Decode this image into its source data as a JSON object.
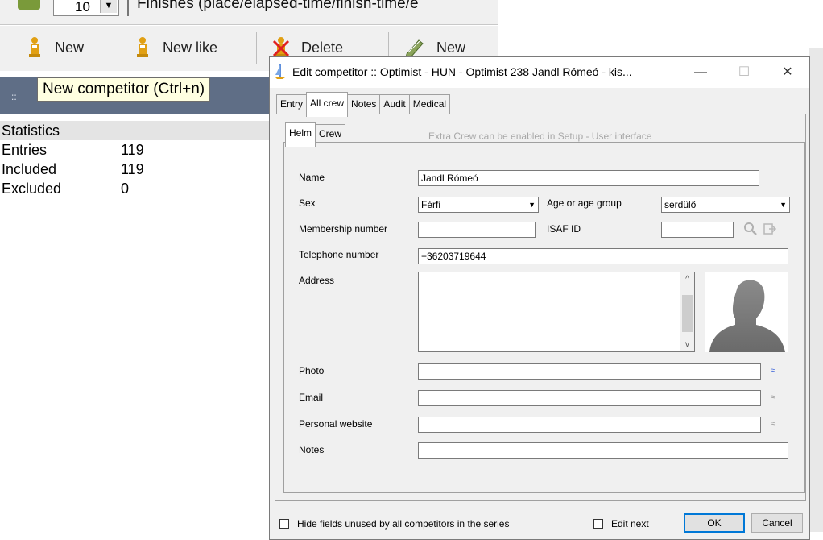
{
  "app": {
    "top_combo_value": "10",
    "finishes_text": "Finishes (place/elapsed-time/finish-time/e",
    "toolbar": {
      "new_label": "New",
      "new_like_label": "New like",
      "delete_label": "Delete",
      "new2_label": "New"
    },
    "tooltip": "New competitor (Ctrl+n)",
    "stats": {
      "title": "Statistics",
      "rows": [
        {
          "label": "Entries",
          "value": "119"
        },
        {
          "label": "Included",
          "value": "119"
        },
        {
          "label": "Excluded",
          "value": "0"
        }
      ]
    }
  },
  "dialog": {
    "title": "Edit competitor :: Optimist - HUN - Optimist 238 Jandl Rómeó - kis...",
    "tabs": [
      "Entry",
      "All crew",
      "Notes",
      "Audit",
      "Medical"
    ],
    "active_tab": "All crew",
    "subtabs": [
      "Helm",
      "Crew"
    ],
    "active_subtab": "Helm",
    "hint": "Extra Crew can be enabled in Setup - User interface",
    "fields": {
      "name_label": "Name",
      "name_value": "Jandl Rómeó",
      "sex_label": "Sex",
      "sex_value": "Férfi",
      "age_label": "Age or age group",
      "age_value": "serdülő",
      "membership_label": "Membership number",
      "membership_value": "",
      "isaf_label": "ISAF ID",
      "isaf_value": "",
      "telephone_label": "Telephone number",
      "telephone_value": "+36203719644",
      "address_label": "Address",
      "address_value": "",
      "photo_label": "Photo",
      "photo_value": "",
      "email_label": "Email",
      "email_value": "",
      "website_label": "Personal website",
      "website_value": "",
      "notes_label": "Notes",
      "notes_value": ""
    },
    "footer": {
      "hide_fields_label": "Hide fields unused by all competitors in the series",
      "edit_next_label": "Edit next",
      "ok_label": "OK",
      "cancel_label": "Cancel"
    },
    "colors": {
      "link_active": "#3a62d9",
      "link_inactive": "#9a9a9a",
      "default_button_border": "#0078d7"
    }
  }
}
